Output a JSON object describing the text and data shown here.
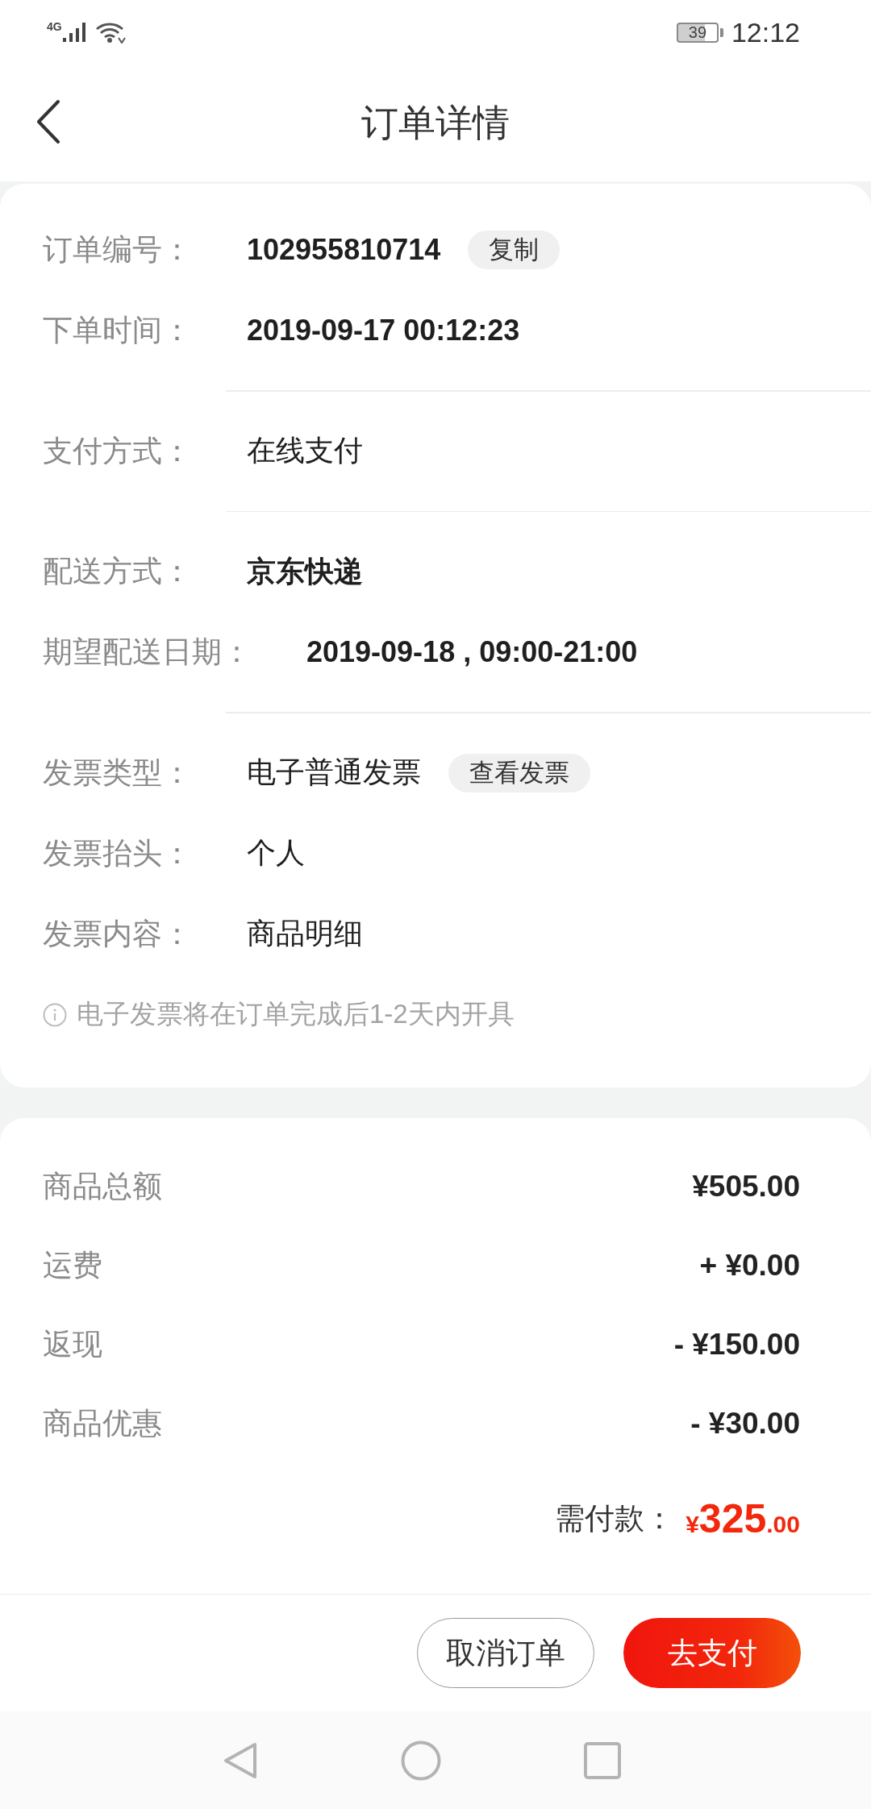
{
  "status_bar": {
    "network": "4G",
    "battery": "39",
    "time": "12:12"
  },
  "header": {
    "title": "订单详情"
  },
  "order_info": {
    "groups": [
      {
        "rows": [
          {
            "label": "订单编号：",
            "value": "102955810714",
            "bold": true,
            "action": "复制"
          },
          {
            "label": "下单时间：",
            "value": "2019-09-17 00:12:23",
            "bold": true
          }
        ]
      },
      {
        "rows": [
          {
            "label": "支付方式：",
            "value": "在线支付",
            "bold": false
          }
        ]
      },
      {
        "rows": [
          {
            "label": "配送方式：",
            "value": "京东快递",
            "bold": true
          },
          {
            "label": "期望配送日期：",
            "value": "2019-09-18 , 09:00-21:00",
            "bold": true
          }
        ]
      },
      {
        "rows": [
          {
            "label": "发票类型：",
            "value": "电子普通发票",
            "bold": false,
            "action": "查看发票"
          },
          {
            "label": "发票抬头：",
            "value": "个人",
            "bold": false
          },
          {
            "label": "发票内容：",
            "value": "商品明细",
            "bold": false
          }
        ],
        "note": "电子发票将在订单完成后1-2天内开具"
      }
    ]
  },
  "price_summary": {
    "rows": [
      {
        "label": "商品总额",
        "value": "¥505.00"
      },
      {
        "label": "运费",
        "value": "+ ¥0.00"
      },
      {
        "label": "返现",
        "value": "- ¥150.00"
      },
      {
        "label": "商品优惠",
        "value": "- ¥30.00"
      }
    ],
    "total": {
      "label": "需付款：",
      "currency": "¥",
      "integer": "325",
      "decimal": ".00"
    }
  },
  "actions": [
    {
      "label": "取消订单",
      "kind": "secondary"
    },
    {
      "label": "去支付",
      "kind": "primary"
    }
  ]
}
